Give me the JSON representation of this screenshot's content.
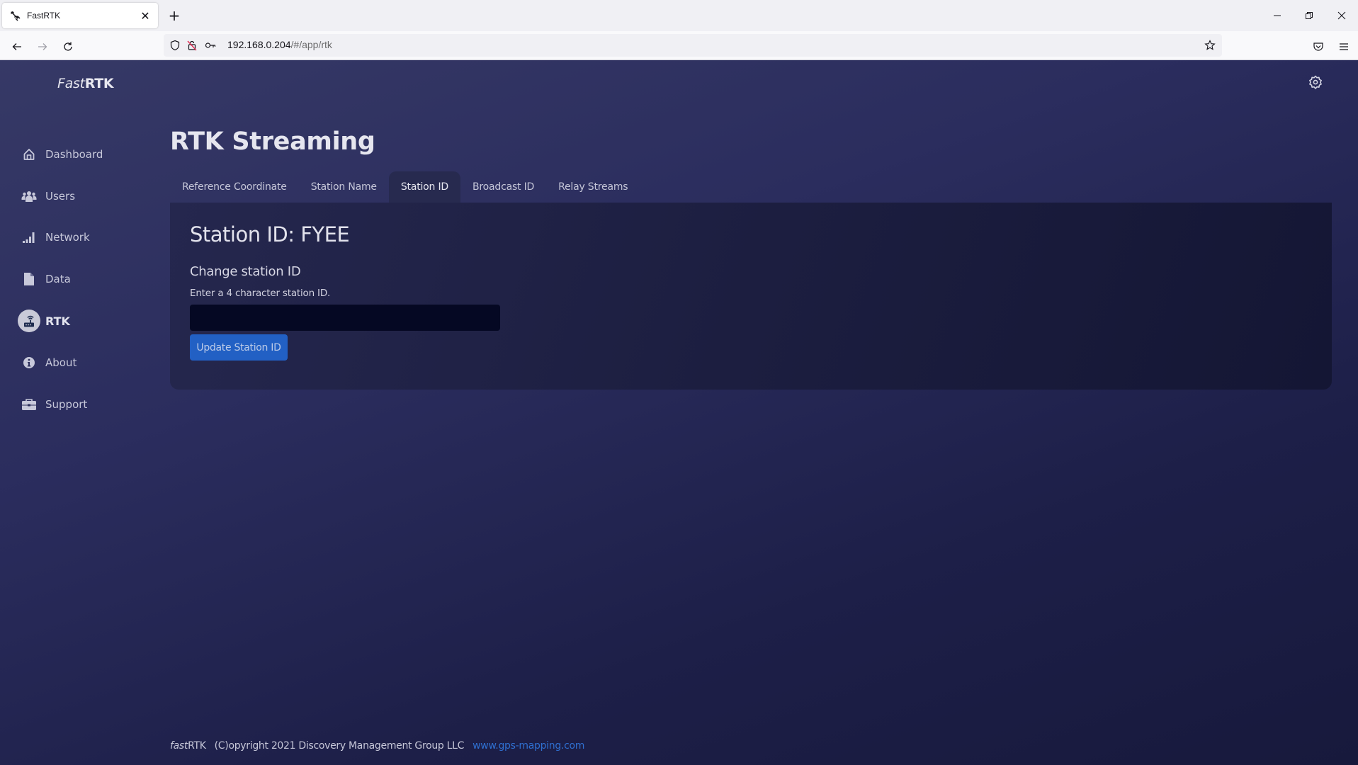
{
  "browser": {
    "tab": {
      "title": "FastRTK",
      "favicon": "satellite-icon"
    },
    "new_tab_label": "+",
    "url": {
      "host": "192.168.0.204",
      "path": "/#/app/rtk"
    }
  },
  "app": {
    "logo": {
      "italic": "Fast",
      "bold": "RTK"
    },
    "settings_icon": "gear-icon"
  },
  "sidebar": {
    "items": [
      {
        "label": "Dashboard",
        "icon": "home-icon",
        "active": false
      },
      {
        "label": "Users",
        "icon": "users-icon",
        "active": false
      },
      {
        "label": "Network",
        "icon": "signal-icon",
        "active": false
      },
      {
        "label": "Data",
        "icon": "file-icon",
        "active": false
      },
      {
        "label": "RTK",
        "icon": "router-icon",
        "active": true
      },
      {
        "label": "About",
        "icon": "info-icon",
        "active": false
      },
      {
        "label": "Support",
        "icon": "briefcase-icon",
        "active": false
      }
    ]
  },
  "main": {
    "title": "RTK Streaming",
    "tabs": [
      {
        "label": "Reference Coordinate",
        "active": false
      },
      {
        "label": "Station Name",
        "active": false
      },
      {
        "label": "Station ID",
        "active": true
      },
      {
        "label": "Broadcast ID",
        "active": false
      },
      {
        "label": "Relay Streams",
        "active": false
      }
    ],
    "panel": {
      "heading": "Station ID: FYEE",
      "subheading": "Change station ID",
      "help": "Enter a 4 character station ID.",
      "input_value": "",
      "button_label": "Update Station ID"
    }
  },
  "footer": {
    "brand_italic": "fast",
    "brand_rest": "RTK",
    "copyright": "(C)opyright 2021 Discovery Management Group LLC",
    "link_text": "www.gps-mapping.com"
  },
  "colors": {
    "accent": "#2260c4",
    "link": "#2f6fd0",
    "background_top": "#363966",
    "background_bottom": "#17193c"
  }
}
